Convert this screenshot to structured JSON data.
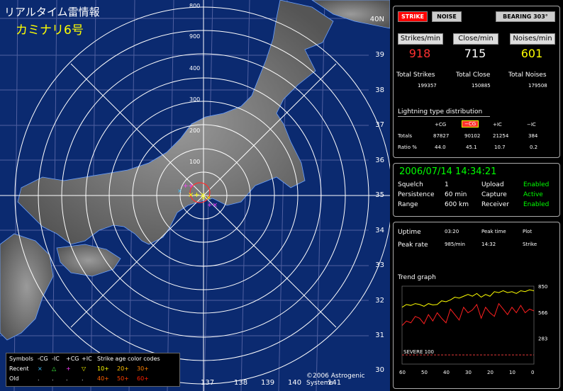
{
  "map": {
    "title": "リアルタイム雷情報",
    "subtitle": "カミナリ6号",
    "lat_labels": [
      "40N",
      "39",
      "38",
      "37",
      "36",
      "35",
      "34",
      "33",
      "32",
      "31",
      "30"
    ],
    "lon_labels": [
      "137",
      "138",
      "139",
      "140",
      "141"
    ],
    "range_labels": [
      "800",
      "900",
      "400",
      "300",
      "200",
      "100"
    ],
    "copyright": "©2006 Astrogenic Systems"
  },
  "legend": {
    "header": [
      "Symbols",
      "-CG",
      "-IC",
      "+CG",
      "+IC",
      "Strike age color codes"
    ],
    "recent_label": "Recent",
    "old_label": "Old",
    "recent_symbols": [
      "×",
      "△",
      "+",
      "▽"
    ],
    "old_symbols": [
      ".",
      ".",
      ".",
      "."
    ],
    "age_recent": [
      "10+",
      "20+",
      "30+"
    ],
    "age_old": [
      "40+",
      "50+",
      "60+"
    ]
  },
  "top_buttons": {
    "strike": "STRIKE",
    "noise": "NOISE",
    "bearing": "BEARING 303°"
  },
  "rates": {
    "strikes_label": "Strikes/min",
    "close_label": "Close/min",
    "noises_label": "Noises/min",
    "strikes": "918",
    "close": "715",
    "noises": "601"
  },
  "totals": {
    "strikes_label": "Total Strikes",
    "close_label": "Total Close",
    "noises_label": "Total Noises",
    "strikes": "199357",
    "close": "150885",
    "noises": "179508"
  },
  "distribution": {
    "title": "Lightning type distribution",
    "headers": [
      "+CG",
      "−CG",
      "+IC",
      "−IC"
    ],
    "totals_label": "Totals",
    "totals": [
      "87827",
      "90102",
      "21254",
      "384"
    ],
    "ratio_label": "Ratio %",
    "ratio": [
      "44.0",
      "45.1",
      "10.7",
      "0.2"
    ]
  },
  "status": {
    "datetime": "2006/07/14 14:34:21",
    "squelch_label": "Squelch",
    "squelch": "1",
    "persistence_label": "Persistence",
    "persistence": "60 min",
    "range_label": "Range",
    "range": "600 km",
    "upload_label": "Upload",
    "upload": "Enabled",
    "capture_label": "Capture",
    "capture": "Active",
    "receiver_label": "Receiver",
    "receiver": "Enabled",
    "accent": "#00ff00"
  },
  "peak": {
    "uptime_label": "Uptime",
    "uptime": "03:20",
    "peak_time_label": "Peak time",
    "peak_time": "14:32",
    "plot_label": "Plot",
    "plot": "Strike",
    "peak_rate_label": "Peak rate",
    "peak_rate": "985/min"
  },
  "trend": {
    "title": "Trend graph",
    "y_ticks": [
      "850",
      "566",
      "283"
    ],
    "x_ticks": [
      "60",
      "50",
      "40",
      "30",
      "20",
      "10",
      "0"
    ],
    "severe_label": "SEVERE 100",
    "colors": {
      "yellow": "#ffff00",
      "red": "#ff2020",
      "severe": "#ff4040"
    }
  },
  "chart_data": {
    "type": "line",
    "title": "Trend graph",
    "x": [
      60,
      58,
      56,
      54,
      52,
      50,
      48,
      46,
      44,
      42,
      40,
      38,
      36,
      34,
      32,
      30,
      28,
      26,
      24,
      22,
      20,
      18,
      16,
      14,
      12,
      10,
      8,
      6,
      4,
      2,
      0
    ],
    "ylim": [
      0,
      850
    ],
    "series": [
      {
        "values": [
          620,
          650,
          640,
          660,
          650,
          630,
          660,
          645,
          650,
          690,
          680,
          700,
          730,
          720,
          740,
          760,
          740,
          770,
          730,
          760,
          740,
          790,
          780,
          800,
          780,
          790,
          770,
          800,
          790,
          810,
          800
        ]
      },
      {
        "values": [
          420,
          470,
          450,
          520,
          500,
          440,
          540,
          470,
          560,
          500,
          450,
          600,
          540,
          480,
          620,
          560,
          590,
          650,
          500,
          620,
          560,
          520,
          660,
          600,
          540,
          620,
          560,
          640,
          560,
          600,
          580
        ]
      }
    ]
  }
}
